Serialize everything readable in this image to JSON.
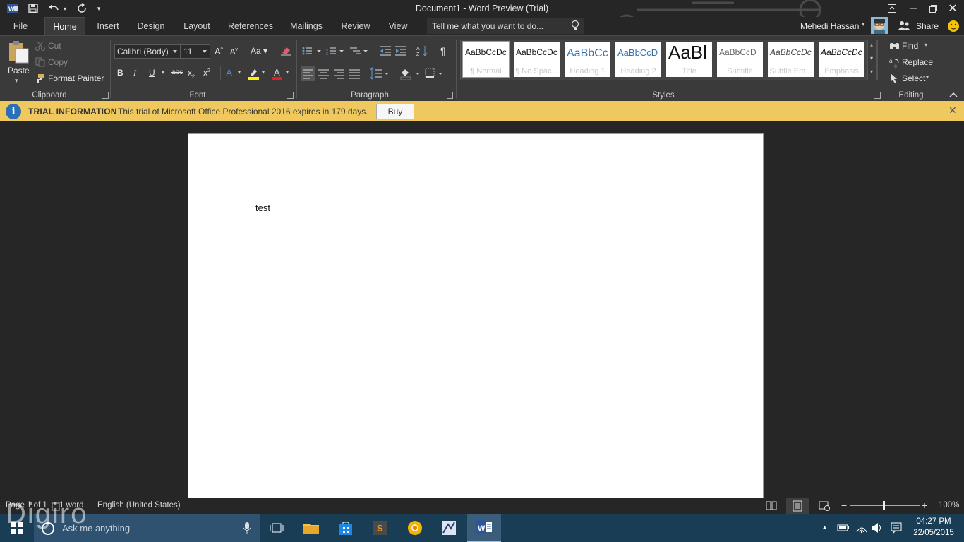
{
  "window": {
    "title": "Document1 - Word Preview (Trial)"
  },
  "quick_access": {
    "app_icon": "word-icon",
    "save": "save-icon",
    "undo": "undo-icon",
    "redo": "redo-icon",
    "customize": "customize-icon"
  },
  "tabs": [
    "File",
    "Home",
    "Insert",
    "Design",
    "Layout",
    "References",
    "Mailings",
    "Review",
    "View"
  ],
  "tell_me": {
    "placeholder": "Tell me what you want to do..."
  },
  "user": {
    "name": "Mehedi Hassan",
    "share_label": "Share"
  },
  "clipboard": {
    "paste_label": "Paste",
    "cut_label": "Cut",
    "copy_label": "Copy",
    "format_painter_label": "Format Painter",
    "group_label": "Clipboard"
  },
  "font": {
    "family": "Calibri (Body)",
    "size": "11",
    "group_label": "Font",
    "bold": "B",
    "italic": "I",
    "underline": "U",
    "strike": "abc",
    "subscript": "x",
    "superscript": "x",
    "case": "Aa",
    "grow": "A",
    "shrink": "A"
  },
  "paragraph": {
    "group_label": "Paragraph"
  },
  "styles": {
    "group_label": "Styles",
    "items": [
      {
        "sample": "AaBbCcDc",
        "name": "¶ Normal"
      },
      {
        "sample": "AaBbCcDc",
        "name": "¶ No Spac..."
      },
      {
        "sample": "AaBbCc",
        "name": "Heading 1"
      },
      {
        "sample": "AaBbCcD",
        "name": "Heading 2"
      },
      {
        "sample": "AaBl",
        "name": "Title"
      },
      {
        "sample": "AaBbCcD",
        "name": "Subtitle"
      },
      {
        "sample": "AaBbCcDc",
        "name": "Subtle Em..."
      },
      {
        "sample": "AaBbCcDc",
        "name": "Emphasis"
      }
    ]
  },
  "editing": {
    "find_label": "Find",
    "replace_label": "Replace",
    "select_label": "Select",
    "group_label": "Editing"
  },
  "trial": {
    "title": "TRIAL INFORMATION",
    "message": "This trial of Microsoft Office Professional 2016 expires in 179 days.",
    "buy_label": "Buy"
  },
  "document": {
    "text": "test"
  },
  "status": {
    "page": "Page 1 of 1",
    "words": "1 word",
    "language": "English (United States)",
    "zoom": "100%"
  },
  "taskbar": {
    "search_placeholder": "Ask me anything",
    "time": "04:27 PM",
    "date": "22/05/2015"
  },
  "watermark": "Digiro",
  "colors": {
    "trial_bar": "#f0c95e",
    "ribbon": "#3a3a3a",
    "taskbar": "#1a3d56",
    "word_blue": "#2b579a"
  }
}
